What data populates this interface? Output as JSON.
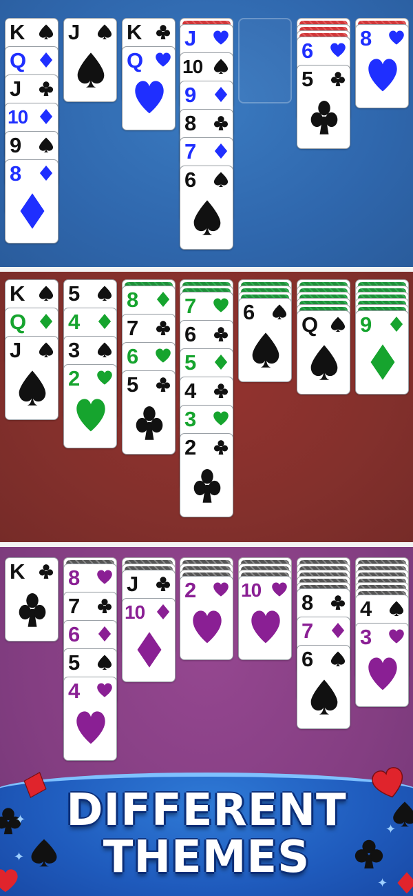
{
  "colors": {
    "blue_theme_red_suit": "#1f2fff",
    "green_theme_red_suit": "#16a42e",
    "purple_theme_red_suit": "#8a1f94",
    "black_suit": "#111111"
  },
  "themes": [
    {
      "name": "blue",
      "accent": "#1f2fff",
      "back_style": "red",
      "columns": [
        {
          "backs": 0,
          "cards": [
            {
              "rank": "K",
              "suit": "spade"
            },
            {
              "rank": "Q",
              "suit": "diamond"
            },
            {
              "rank": "J",
              "suit": "club"
            },
            {
              "rank": "10",
              "suit": "diamond"
            },
            {
              "rank": "9",
              "suit": "spade"
            },
            {
              "rank": "8",
              "suit": "diamond"
            }
          ]
        },
        {
          "backs": 0,
          "cards": [
            {
              "rank": "J",
              "suit": "spade"
            }
          ]
        },
        {
          "backs": 0,
          "cards": [
            {
              "rank": "K",
              "suit": "club"
            },
            {
              "rank": "Q",
              "suit": "heart"
            }
          ]
        },
        {
          "backs": 1,
          "cards": [
            {
              "rank": "J",
              "suit": "heart"
            },
            {
              "rank": "10",
              "suit": "spade"
            },
            {
              "rank": "9",
              "suit": "diamond"
            },
            {
              "rank": "8",
              "suit": "club"
            },
            {
              "rank": "7",
              "suit": "diamond"
            },
            {
              "rank": "6",
              "suit": "spade"
            }
          ]
        },
        {
          "backs": 0,
          "cards": [],
          "empty": true
        },
        {
          "backs": 3,
          "cards": [
            {
              "rank": "6",
              "suit": "heart"
            },
            {
              "rank": "5",
              "suit": "club"
            }
          ]
        },
        {
          "backs": 1,
          "cards": [
            {
              "rank": "8",
              "suit": "heart"
            }
          ]
        }
      ]
    },
    {
      "name": "red",
      "accent": "#16a42e",
      "back_style": "green",
      "columns": [
        {
          "backs": 0,
          "cards": [
            {
              "rank": "K",
              "suit": "spade"
            },
            {
              "rank": "Q",
              "suit": "diamond"
            },
            {
              "rank": "J",
              "suit": "spade"
            }
          ]
        },
        {
          "backs": 0,
          "cards": [
            {
              "rank": "5",
              "suit": "spade"
            },
            {
              "rank": "4",
              "suit": "diamond"
            },
            {
              "rank": "3",
              "suit": "spade"
            },
            {
              "rank": "2",
              "suit": "heart"
            }
          ]
        },
        {
          "backs": 1,
          "cards": [
            {
              "rank": "8",
              "suit": "diamond"
            },
            {
              "rank": "7",
              "suit": "club"
            },
            {
              "rank": "6",
              "suit": "heart"
            },
            {
              "rank": "5",
              "suit": "club"
            }
          ]
        },
        {
          "backs": 2,
          "cards": [
            {
              "rank": "7",
              "suit": "heart"
            },
            {
              "rank": "6",
              "suit": "club"
            },
            {
              "rank": "5",
              "suit": "diamond"
            },
            {
              "rank": "4",
              "suit": "club"
            },
            {
              "rank": "3",
              "suit": "heart"
            },
            {
              "rank": "2",
              "suit": "club"
            }
          ]
        },
        {
          "backs": 3,
          "cards": [
            {
              "rank": "6",
              "suit": "spade"
            }
          ]
        },
        {
          "backs": 5,
          "cards": [
            {
              "rank": "Q",
              "suit": "spade"
            }
          ]
        },
        {
          "backs": 5,
          "cards": [
            {
              "rank": "9",
              "suit": "diamond"
            }
          ]
        }
      ]
    },
    {
      "name": "purple",
      "accent": "#8a1f94",
      "back_style": "gray",
      "columns": [
        {
          "backs": 0,
          "cards": [
            {
              "rank": "K",
              "suit": "club"
            }
          ]
        },
        {
          "backs": 1,
          "cards": [
            {
              "rank": "8",
              "suit": "heart"
            },
            {
              "rank": "7",
              "suit": "club"
            },
            {
              "rank": "6",
              "suit": "diamond"
            },
            {
              "rank": "5",
              "suit": "spade"
            },
            {
              "rank": "4",
              "suit": "heart"
            }
          ]
        },
        {
          "backs": 2,
          "cards": [
            {
              "rank": "J",
              "suit": "club"
            },
            {
              "rank": "10",
              "suit": "diamond"
            }
          ]
        },
        {
          "backs": 3,
          "cards": [
            {
              "rank": "2",
              "suit": "heart"
            }
          ]
        },
        {
          "backs": 3,
          "cards": [
            {
              "rank": "10",
              "suit": "heart"
            }
          ]
        },
        {
          "backs": 5,
          "cards": [
            {
              "rank": "8",
              "suit": "club"
            },
            {
              "rank": "7",
              "suit": "diamond"
            },
            {
              "rank": "6",
              "suit": "spade"
            }
          ]
        },
        {
          "backs": 6,
          "cards": [
            {
              "rank": "4",
              "suit": "spade"
            },
            {
              "rank": "3",
              "suit": "heart"
            }
          ]
        }
      ]
    }
  ],
  "banner": {
    "line1": "DIFFERENT",
    "line2": "THEMES",
    "background": "#1f5bbd",
    "text_color": "#ffffff",
    "decorations": [
      "spade-icon",
      "heart-icon",
      "club-icon",
      "diamond-icon"
    ]
  }
}
